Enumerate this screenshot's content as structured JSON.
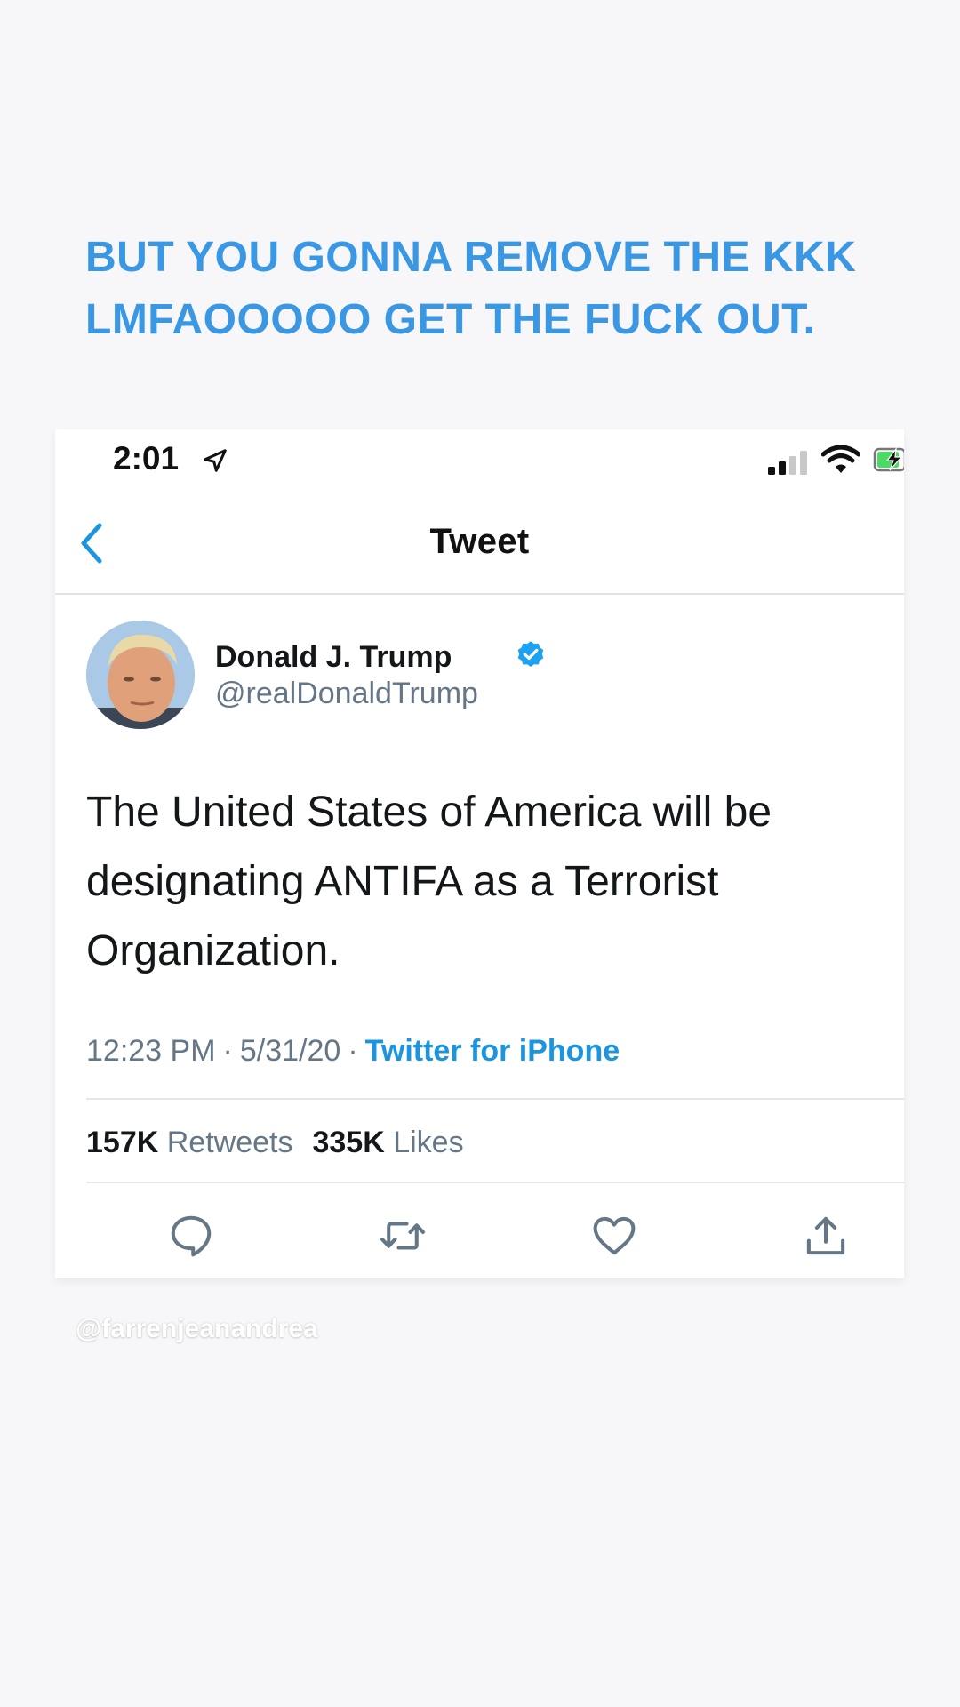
{
  "caption": {
    "line1": "BUT YOU GONNA REMOVE THE KKK",
    "line2": "LMFAOOOOO GET THE FUCK OUT."
  },
  "status_bar": {
    "time": "2:01",
    "icons": [
      "location-arrow-icon",
      "cellular-signal-icon",
      "wifi-icon",
      "battery-charging-icon"
    ]
  },
  "nav": {
    "back_icon": "chevron-left-icon",
    "title": "Tweet"
  },
  "tweet": {
    "author_name": "Donald J. Trump",
    "verified": true,
    "handle": "@realDonaldTrump",
    "text": "The United States of America will be designating ANTIFA as a Terrorist Organization.",
    "time": "12:23 PM",
    "date": "5/31/20",
    "separator": "·",
    "source": "Twitter for iPhone",
    "retweets_count": "157K",
    "retweets_label": "Retweets",
    "likes_count": "335K",
    "likes_label": "Likes",
    "actions": [
      "reply-icon",
      "retweet-icon",
      "like-icon",
      "share-icon"
    ]
  },
  "watermark": "@farrenjeanandrea",
  "colors": {
    "caption": "#3a97e3",
    "twitter_blue": "#1b95e0",
    "secondary_text": "#657786",
    "primary_text": "#14171a",
    "background": "#f7f7f9"
  }
}
